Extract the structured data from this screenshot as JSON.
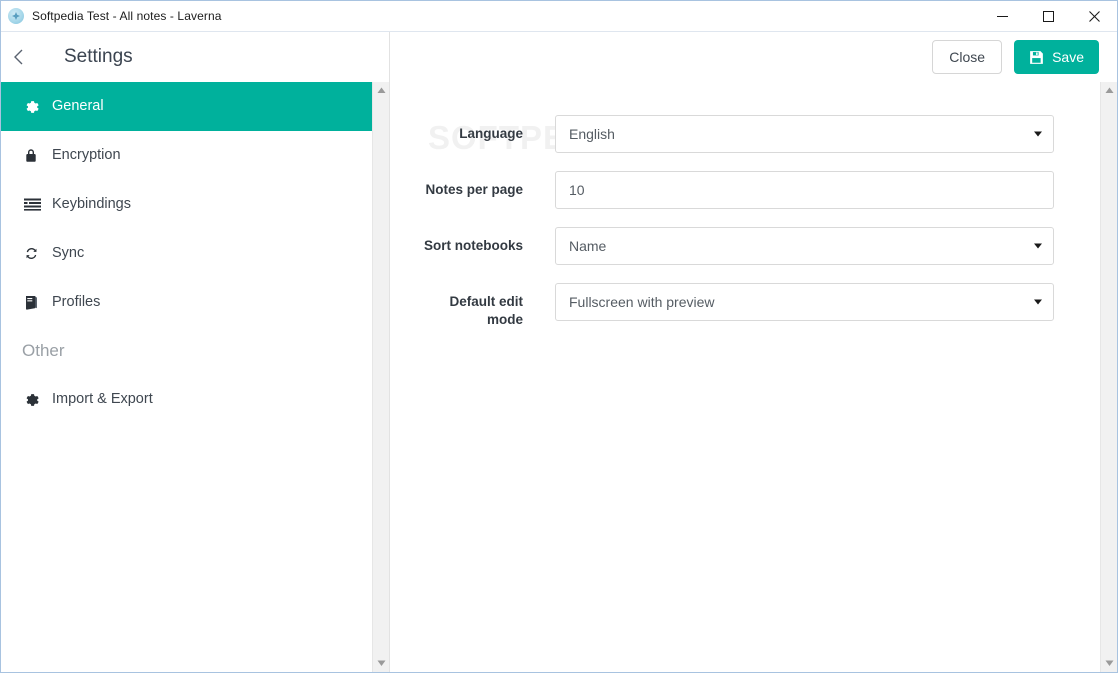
{
  "window": {
    "title": "Softpedia Test - All notes - Laverna",
    "app_icon": "laverna-app-icon",
    "controls": {
      "minimize": "minimize-icon",
      "maximize": "maximize-icon",
      "close": "close-icon"
    }
  },
  "settings_header": {
    "back_icon": "chevron-left-icon",
    "title": "Settings"
  },
  "sidebar": {
    "items": [
      {
        "label": "General",
        "icon": "gear-icon",
        "active": true
      },
      {
        "label": "Encryption",
        "icon": "lock-icon",
        "active": false
      },
      {
        "label": "Keybindings",
        "icon": "list-alt-icon",
        "active": false
      },
      {
        "label": "Sync",
        "icon": "refresh-icon",
        "active": false
      },
      {
        "label": "Profiles",
        "icon": "book-icon",
        "active": false
      }
    ],
    "section_other": "Other",
    "other_items": [
      {
        "label": "Import & Export",
        "icon": "gear-icon",
        "active": false
      }
    ]
  },
  "toolbar": {
    "close_label": "Close",
    "save_label": "Save",
    "save_icon": "floppy-disk-icon"
  },
  "form": {
    "fields": [
      {
        "label": "Language",
        "type": "select",
        "value": "English"
      },
      {
        "label": "Notes per page",
        "type": "number",
        "value": "10"
      },
      {
        "label": "Sort notebooks",
        "type": "select",
        "value": "Name"
      },
      {
        "label": "Default edit mode",
        "type": "select",
        "value": "Fullscreen with preview"
      }
    ]
  },
  "watermark": {
    "text": "SOFTPEDIA"
  },
  "colors": {
    "accent": "#00b19c",
    "text": "#3f4750",
    "muted": "#9aa0a6",
    "border": "#d9d9d9"
  }
}
